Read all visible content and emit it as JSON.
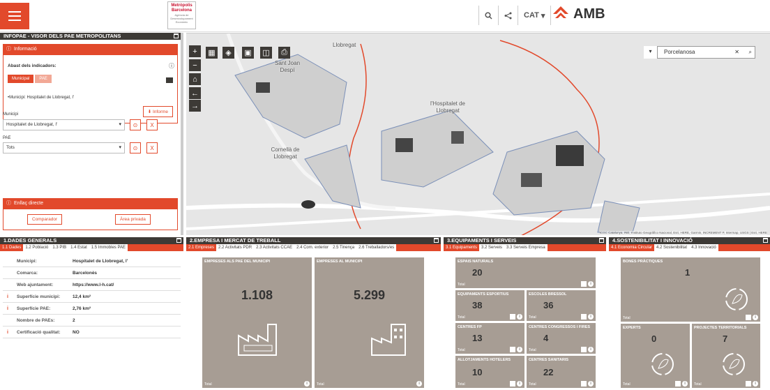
{
  "topbar": {
    "logo": {
      "line1": "Metròpolis",
      "line2": "Barcelona",
      "line3": "Agència de Desenvolupament Econòmic"
    },
    "lang": "CAT",
    "brand": "AMB",
    "icons": [
      "search-icon",
      "share-icon"
    ]
  },
  "left_panel": {
    "title": "INFOPAE - VISOR DELS PAE METROPOLITANS",
    "info_title": "Informació",
    "abast_label": "Abast dels indicadors:",
    "btn_municipal": "Municipal",
    "btn_pae": "PAE",
    "municipi_line": "•Municipi: Hospitalet de Llobregat, l'",
    "informe_btn": "Informe",
    "municipi_label": "Municipi",
    "municipi_value": "Hospitalet de Llobregat, l'",
    "pae_label": "PAE",
    "pae_value": "Tots",
    "enllac_title": "Enllaç directe",
    "comparador_btn": "Comparador",
    "area_btn": "Àrea privada"
  },
  "map": {
    "search_value": "Porcelanosa",
    "labels": {
      "llobregat": "Llobregat",
      "sant_joan": "Sant Joan Despí",
      "hospitalet": "l'Hospitalet de Llobregat",
      "cornella": "Cornellà de Llobregat"
    },
    "attribution": "ICGC Catalunya, INE, Instituto Geográfico Nacional, Esri, HERE, Garmin, INCREMENT P, Intermap, USGS | Esri, HERE"
  },
  "sec1": {
    "title": "1.DADES GENERALS",
    "tabs": [
      "1.1 Dades",
      "1.2 Població",
      "1.3 PIB",
      "1.4 Estat",
      "1.5 Immobles PAE"
    ],
    "rows": [
      {
        "k": "Municipi:",
        "v": "Hospitalet de Llobregat, l'",
        "i": ""
      },
      {
        "k": "Comarca:",
        "v": "Barcelonès",
        "i": ""
      },
      {
        "k": "Web ajuntament:",
        "v": "https://www.l-h.cat/",
        "i": ""
      },
      {
        "k": "Superfície municipi:",
        "v": "12,4 km²",
        "i": "i"
      },
      {
        "k": "Superfície PAE:",
        "v": "2,76 km²",
        "i": "i"
      },
      {
        "k": "Nombre de PAEs:",
        "v": "2",
        "i": ""
      },
      {
        "k": "Certificació qualitat:",
        "v": "NO",
        "i": "i"
      }
    ]
  },
  "sec2": {
    "title": "2.EMPRESA I MERCAT DE TREBALL",
    "tabs": [
      "2.1 Empreses",
      "2.2 Activitats PDR",
      "2.3 Activitats CCAE",
      "2.4 Com. exterior",
      "2.5 Tinença",
      "2.6 Treballadors/es"
    ],
    "tile1": {
      "title": "EMPRESES ALS PAE DEL MUNICIPI",
      "value": "1.108",
      "foot": "Total"
    },
    "tile2": {
      "title": "EMPRESES AL MUNICIPI",
      "value": "5.299",
      "foot": "Total"
    }
  },
  "sec3": {
    "title": "3.EQUIPAMENTS I SERVEIS",
    "tabs": [
      "3.1 Equipaments",
      "3.2 Serveis",
      "3.3 Serveis Empresa"
    ],
    "tiles": [
      {
        "title": "ESPAIS NATURALS",
        "value": "20",
        "foot": "Total"
      },
      {
        "title": "EQUIPAMENTS ESPORTIUS",
        "value": "38",
        "foot": "Total"
      },
      {
        "title": "ESCOLES BRESSOL",
        "value": "36",
        "foot": "Total"
      },
      {
        "title": "CENTRES FP",
        "value": "13",
        "foot": "Total"
      },
      {
        "title": "CENTRES CONGRESSOS I FIRES",
        "value": "4",
        "foot": "Total"
      },
      {
        "title": "ALLOTJAMENTS HOTELERS",
        "value": "10",
        "foot": "Total"
      },
      {
        "title": "CENTRES SANITARIS",
        "value": "22",
        "foot": "Total"
      }
    ]
  },
  "sec4": {
    "title": "4.SOSTENIBILITAT I INNOVACIÓ",
    "tabs": [
      "4.1 Economia Circular",
      "4.2 Sostenibilitat",
      "4.3 Innovació"
    ],
    "tiles": [
      {
        "title": "BONES PRÀCTIQUES",
        "value": "1",
        "foot": "Total"
      },
      {
        "title": "EXPERTS",
        "value": "0",
        "foot": "Total"
      },
      {
        "title": "PROJECTES TERRITORIALS",
        "value": "7",
        "foot": "Total"
      }
    ]
  },
  "colors": {
    "accent": "#e2492b",
    "header": "#3d3a36",
    "tile": "#a79d94"
  }
}
